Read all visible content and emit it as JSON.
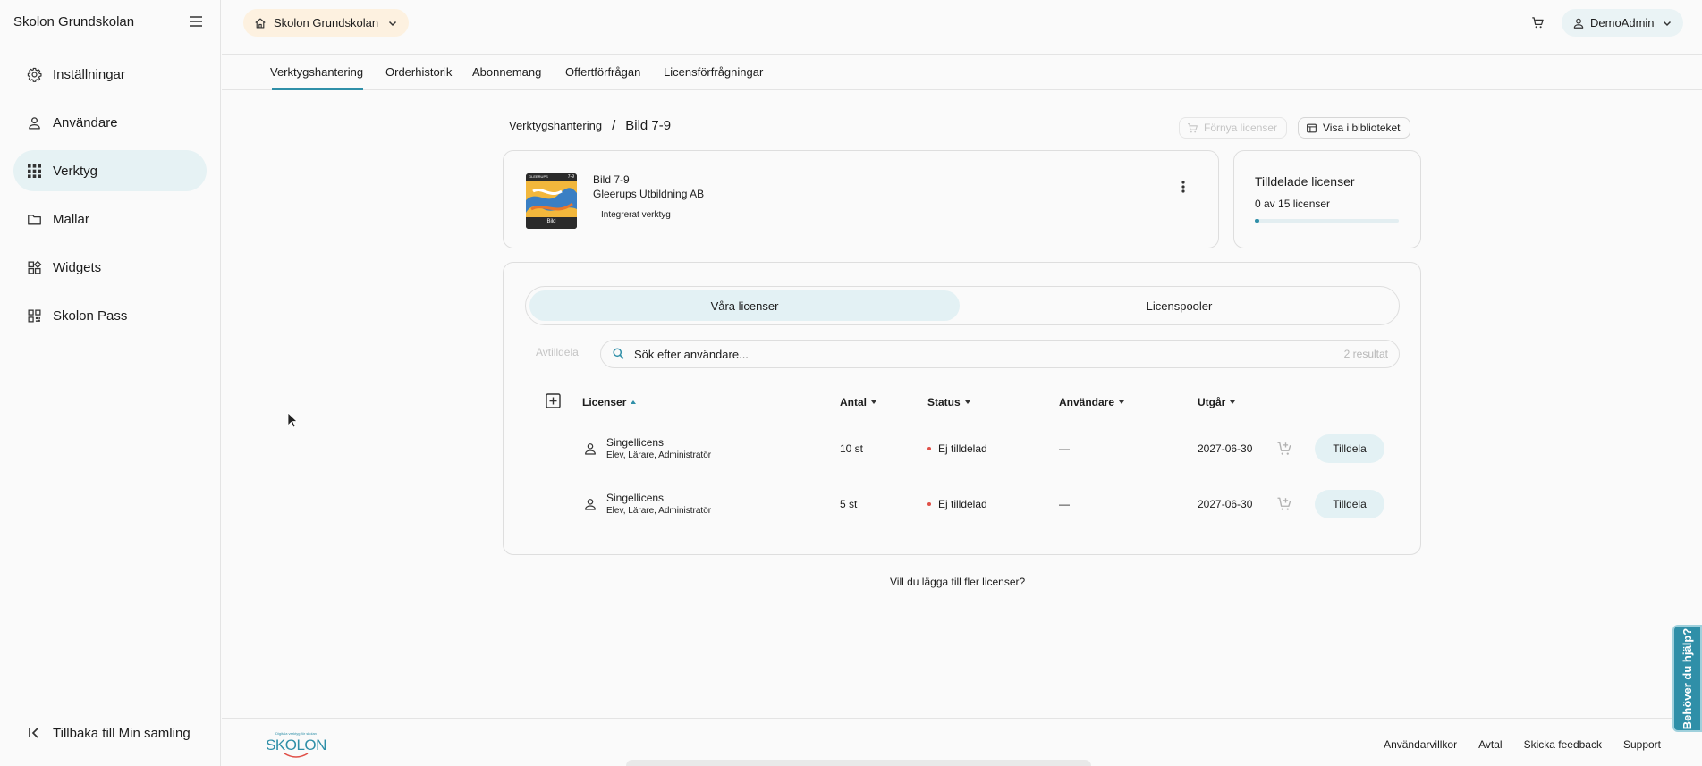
{
  "sidebar": {
    "org_name": "Skolon Grundskolan",
    "items": [
      {
        "label": "Inställningar",
        "icon": "gear-icon"
      },
      {
        "label": "Användare",
        "icon": "user-icon"
      },
      {
        "label": "Verktyg",
        "icon": "grid-icon",
        "active": true
      },
      {
        "label": "Mallar",
        "icon": "folder-icon"
      },
      {
        "label": "Widgets",
        "icon": "widgets-icon"
      },
      {
        "label": "Skolon Pass",
        "icon": "qr-icon"
      }
    ],
    "back_label": "Tillbaka till Min samling"
  },
  "header": {
    "org_selector": "Skolon Grundskolan",
    "user": "DemoAdmin"
  },
  "tabs": [
    {
      "label": "Verktygshantering",
      "active": true
    },
    {
      "label": "Orderhistorik"
    },
    {
      "label": "Abonnemang"
    },
    {
      "label": "Offertförfrågan"
    },
    {
      "label": "Licensförfrågningar"
    }
  ],
  "breadcrumb": {
    "parent": "Verktygshantering",
    "separator": "/",
    "current": "Bild 7-9"
  },
  "actions": {
    "renew": "Förnya licenser",
    "library": "Visa i biblioteket"
  },
  "tool": {
    "title": "Bild 7-9",
    "publisher": "Gleerups Utbildning AB",
    "badge": "Integrerat verktyg",
    "cover_series": "GLEERUPS",
    "cover_grade": "7-9",
    "cover_word": "Bild"
  },
  "assigned": {
    "title": "Tilldelade licenser",
    "count_text": "0 av 15 licenser",
    "fraction": 0.0
  },
  "segments": {
    "ours": "Våra licenser",
    "pools": "Licenspooler"
  },
  "toolbar": {
    "unassign": "Avtilldela",
    "search_placeholder": "Sök efter användare...",
    "results": "2 resultat"
  },
  "table": {
    "columns": {
      "licenses": "Licenser",
      "quantity": "Antal",
      "status": "Status",
      "users": "Användare",
      "expires": "Utgår"
    },
    "rows": [
      {
        "name": "Singellicens",
        "roles": "Elev, Lärare, Administratör",
        "quantity": "10 st",
        "status": "Ej tilldelad",
        "users": "—",
        "expires": "2027-06-30",
        "action": "Tilldela"
      },
      {
        "name": "Singellicens",
        "roles": "Elev, Lärare, Administratör",
        "quantity": "5 st",
        "status": "Ej tilldelad",
        "users": "—",
        "expires": "2027-06-30",
        "action": "Tilldela"
      }
    ]
  },
  "add_more": "Vill du lägga till fler licenser?",
  "footer": {
    "logo": "SKOLON",
    "logo_tagline": "Digitala verktyg för skolan",
    "links": [
      "Användarvillkor",
      "Avtal",
      "Skicka feedback",
      "Support"
    ]
  },
  "help_tab": "Behöver du hjälp?",
  "colors": {
    "accent": "#2f8fa8",
    "active_bg": "#e6f2f4",
    "org_chip_bg": "#fdf1e0",
    "status_dot": "#e05048"
  }
}
